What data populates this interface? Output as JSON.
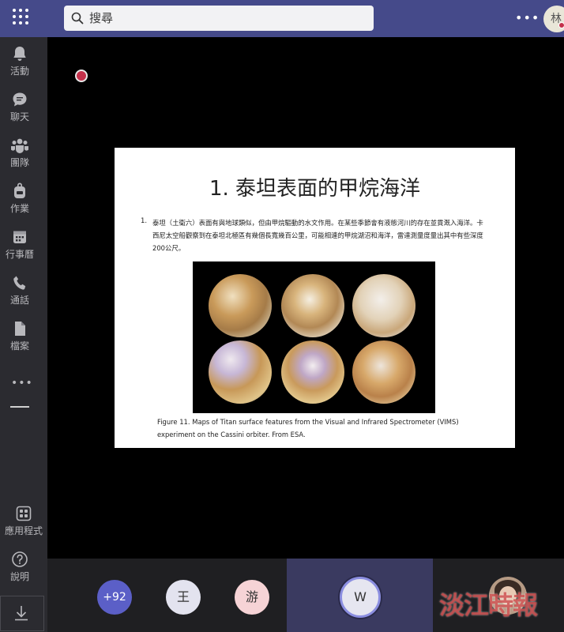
{
  "topbar": {
    "search_placeholder": "搜尋",
    "more_label": "•••",
    "user_initial": "林",
    "accent_color": "#454a8a"
  },
  "sidebar": {
    "items": [
      {
        "label": "活動",
        "icon": "bell-icon"
      },
      {
        "label": "聊天",
        "icon": "chat-icon"
      },
      {
        "label": "團隊",
        "icon": "teams-icon"
      },
      {
        "label": "作業",
        "icon": "backpack-icon"
      },
      {
        "label": "行事曆",
        "icon": "calendar-icon"
      },
      {
        "label": "通話",
        "icon": "phone-icon"
      },
      {
        "label": "檔案",
        "icon": "file-icon"
      }
    ],
    "more_label": "•••",
    "apps_label": "應用程式",
    "help_label": "說明"
  },
  "slide": {
    "title": "1. 泰坦表面的甲烷海洋",
    "item_number": "1.",
    "body": "泰坦（土衛六）表面有與地球類似，但由甲烷驅動的水文作用。在某些季節會有液態河川的存在並貫溉入海洋。卡西尼太空船觀察到在泰坦北極區有幾個長寬幾百公里，可能相連的甲烷湖沼和海洋，雷達測量度量出其中有些深度200公尺。",
    "caption_line1": "Figure 11.  Maps of Titan surface features from the Visual and Infrared Spectrometer (VIMS)",
    "caption_line2": "experiment on the Cassini orbiter. From ESA."
  },
  "call": {
    "overflow_count": "+92",
    "participants": [
      {
        "initial": "王",
        "color": "#e3e3ef"
      },
      {
        "initial": "游",
        "color": "#f6d3d6"
      },
      {
        "initial": "W",
        "color": "#e6e6f0"
      }
    ]
  },
  "watermark": "淡江時報"
}
